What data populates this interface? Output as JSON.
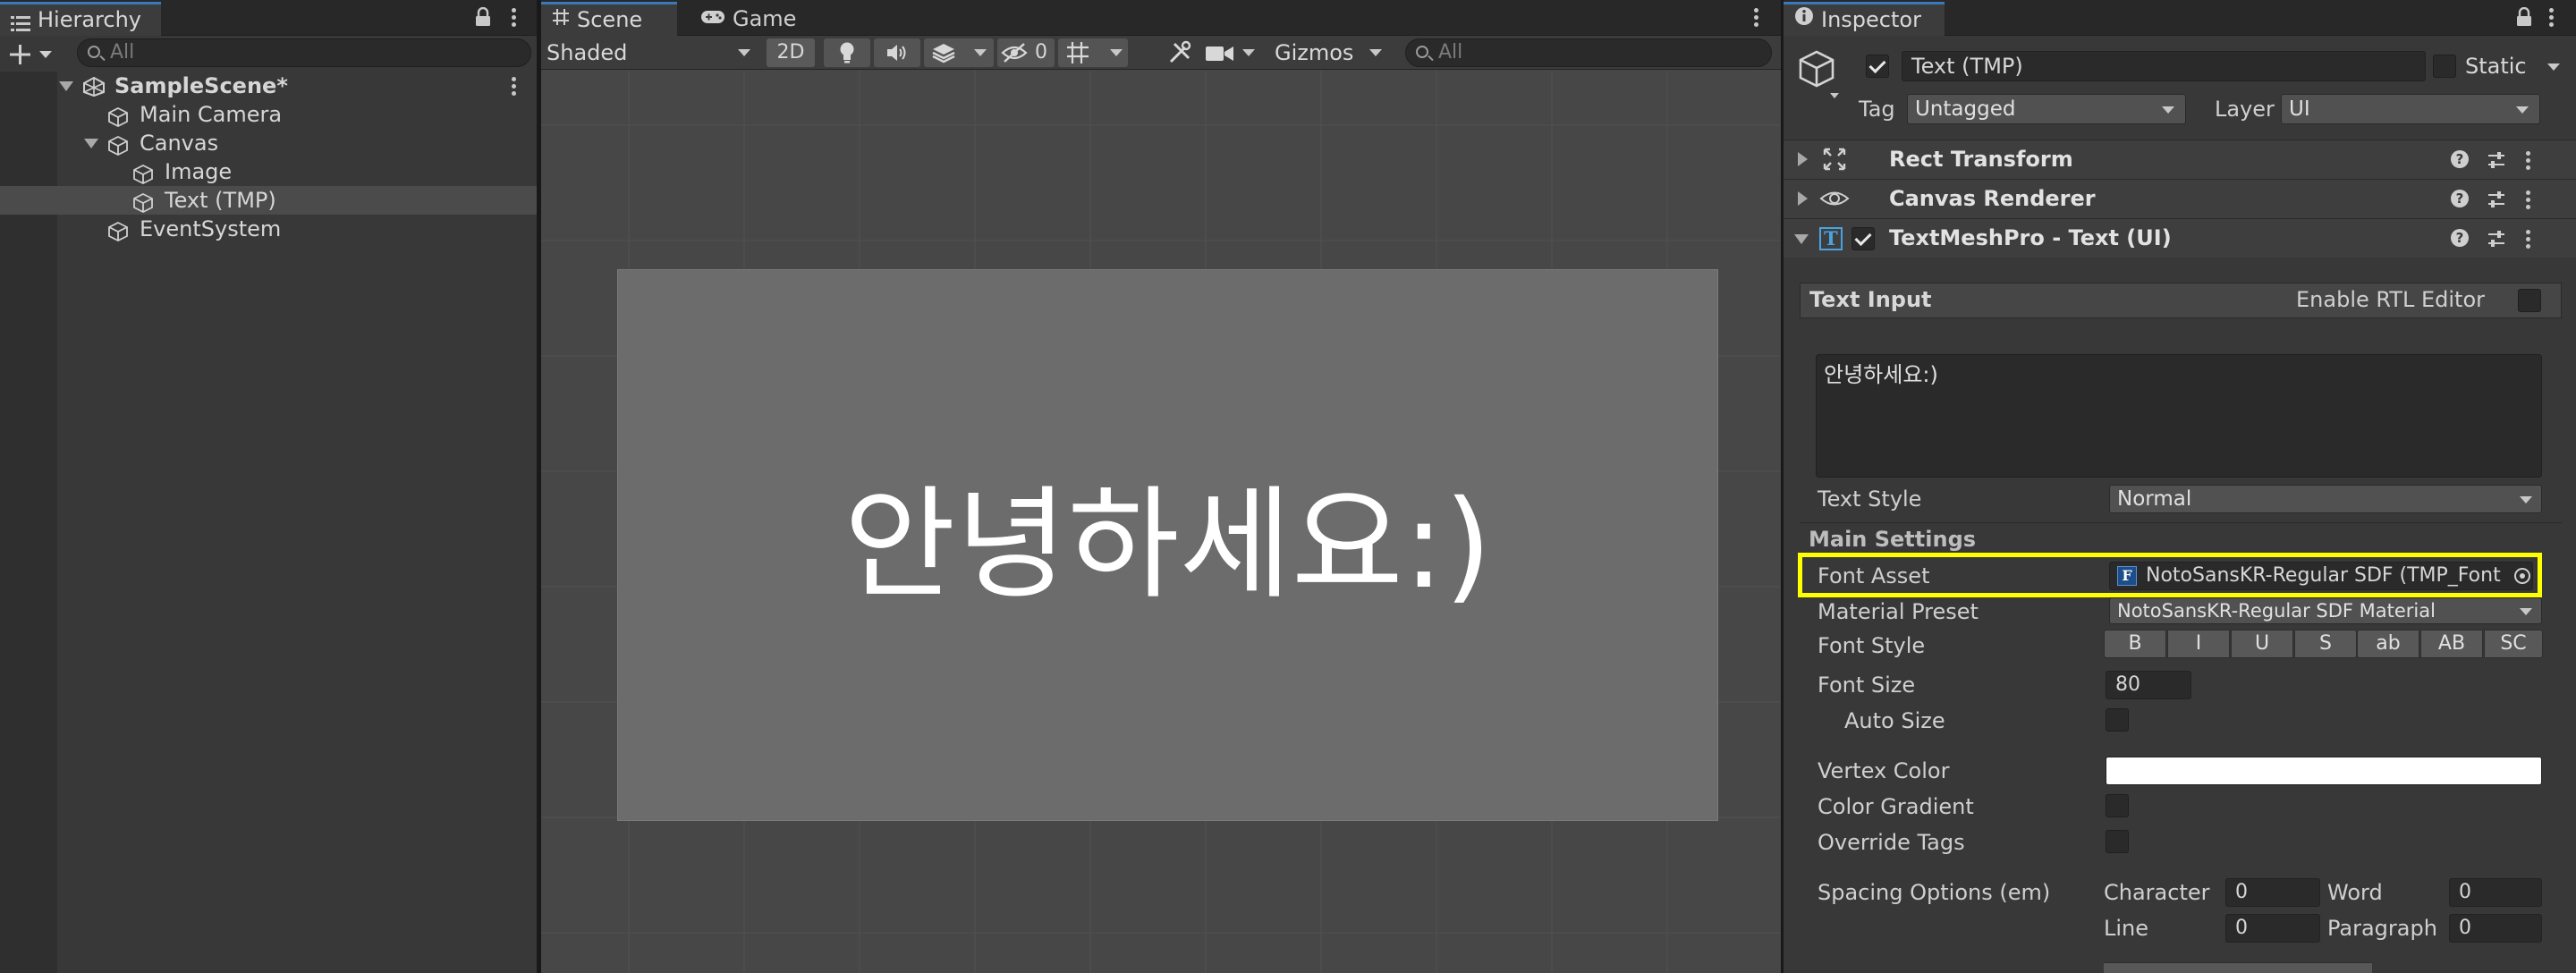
{
  "hierarchy": {
    "tab_label": "Hierarchy",
    "search_placeholder": "All",
    "scene_name": "SampleScene*",
    "items": [
      {
        "label": "Main Camera"
      },
      {
        "label": "Canvas"
      },
      {
        "label": "Image"
      },
      {
        "label": "Text (TMP)"
      },
      {
        "label": "EventSystem"
      }
    ]
  },
  "scene_view": {
    "tabs": [
      {
        "label": "Scene"
      },
      {
        "label": "Game"
      }
    ],
    "shading_mode": "Shaded",
    "mode_2d_label": "2D",
    "hidden_count": "0",
    "gizmos_label": "Gizmos",
    "search_placeholder": "All",
    "canvas_text": "안녕하세요:)"
  },
  "inspector": {
    "tab_label": "Inspector",
    "object_name": "Text (TMP)",
    "object_active": true,
    "static_label": "Static",
    "tag_label": "Tag",
    "tag_value": "Untagged",
    "layer_label": "Layer",
    "layer_value": "UI",
    "components": [
      {
        "name": "Rect Transform"
      },
      {
        "name": "Canvas Renderer"
      },
      {
        "name": "TextMeshPro - Text (UI)"
      }
    ],
    "text_input": {
      "header": "Text Input",
      "rtl_label": "Enable RTL Editor",
      "text_value": "안녕하세요:)"
    },
    "text_style_label": "Text Style",
    "text_style_value": "Normal",
    "main_settings_header": "Main Settings",
    "font_asset_label": "Font Asset",
    "font_asset_value": "NotoSansKR-Regular SDF (TMP_Font",
    "material_preset_label": "Material Preset",
    "material_preset_value": "NotoSansKR-Regular SDF Material",
    "font_style_label": "Font Style",
    "font_style_buttons": [
      {
        "label": "B"
      },
      {
        "label": "I"
      },
      {
        "label": "U"
      },
      {
        "label": "S"
      },
      {
        "label": "ab"
      },
      {
        "label": "AB"
      },
      {
        "label": "SC"
      }
    ],
    "font_size_label": "Font Size",
    "font_size_value": "80",
    "auto_size_label": "Auto Size",
    "vertex_color_label": "Vertex Color",
    "vertex_color_value": "#ffffff",
    "color_gradient_label": "Color Gradient",
    "override_tags_label": "Override Tags",
    "spacing_label": "Spacing Options (em)",
    "character_label": "Character",
    "character_value": "0",
    "word_label": "Word",
    "word_value": "0",
    "line_label": "Line",
    "line_value": "0",
    "paragraph_label": "Paragraph",
    "paragraph_value": "0"
  },
  "colors": {
    "accent": "#3a79bb",
    "highlight": "#ffff00",
    "canvas_rect": "#6c6c6c"
  }
}
